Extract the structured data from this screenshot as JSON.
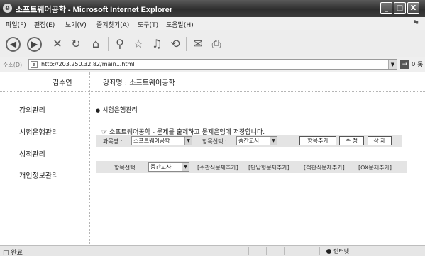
{
  "window": {
    "title": "소프트웨어공학 - Microsoft Internet Explorer",
    "minimize": "_",
    "maximize": "□",
    "close": "X"
  },
  "menu": [
    "파일(F)",
    "편집(E)",
    "보기(V)",
    "즐겨찾기(A)",
    "도구(T)",
    "도움말(H)"
  ],
  "toolbar_icons": [
    "back-icon",
    "forward-icon",
    "stop-icon",
    "refresh-icon",
    "home-icon",
    "search-icon",
    "favorites-icon",
    "media-icon",
    "history-icon",
    "mail-icon",
    "print-icon"
  ],
  "address": {
    "label": "주소(D)",
    "url": "http://203.250.32.82/main1.html",
    "go": "이동"
  },
  "user_name": "김수연",
  "course_title": "강좌명 : 소프트웨어공학",
  "nav": [
    "강의관리",
    "시험은행관리",
    "성적관리",
    "개인정보관리"
  ],
  "section_title": "시험은행관리",
  "notice": "소프트웨어공학 - 문제를 출제하고 문제은행에 저장합니다.",
  "form1": {
    "course_label": "과목명 :",
    "course_value": "소프트웨어공학",
    "item_label": "항목선택 :",
    "item_value": "중간고사",
    "add_item": "항목추가",
    "edit": "수 정",
    "delete": "삭 제"
  },
  "form2": {
    "item_label": "항목선택 :",
    "item_value": "중간고사",
    "links": [
      "[주관식문제추가]",
      "[단답형문제추가]",
      "[객관식문제추가]",
      "[OX문제추가]"
    ]
  },
  "status": {
    "text": "완료",
    "zone": "인터넷"
  }
}
